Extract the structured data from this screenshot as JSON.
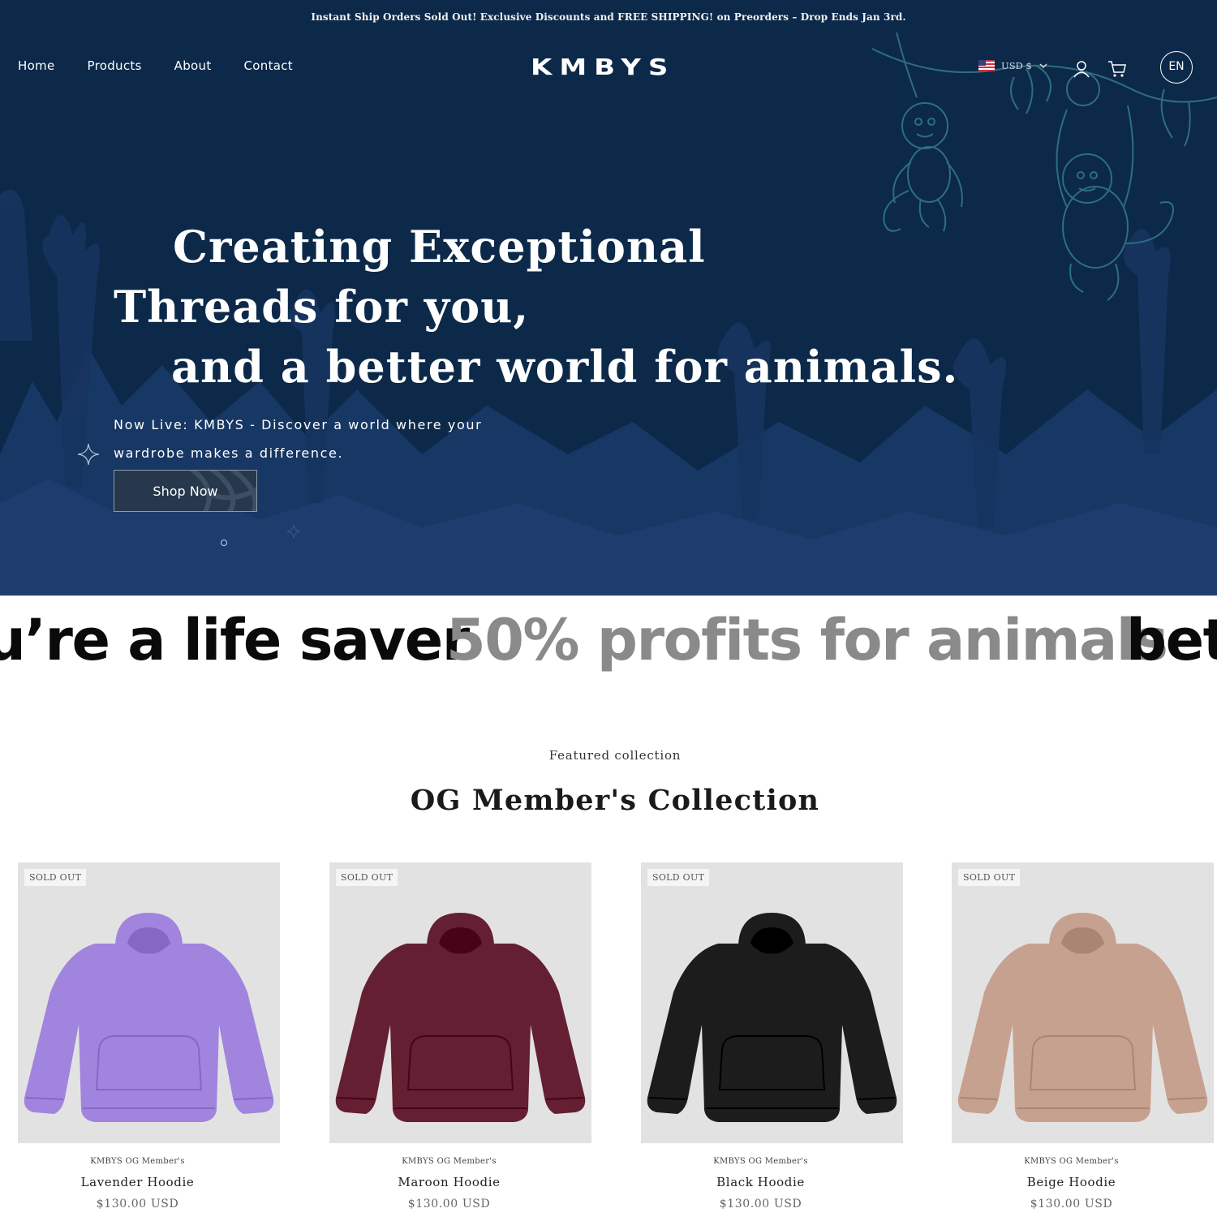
{
  "announcement": "Instant Ship Orders Sold Out! Exclusive Discounts and FREE SHIPPING! on Preorders – Drop Ends Jan 3rd.",
  "nav": [
    "Home",
    "Products",
    "About",
    "Contact"
  ],
  "logo": "KMBYS",
  "currency": "USD $",
  "language": "EN",
  "hero": {
    "title_lines": [
      "Creating Exceptional",
      "Threads for you,",
      "and a better world for animals."
    ],
    "subtitle_lines": [
      "Now Live: KMBYS - Discover a world where your",
      "wardrobe makes a difference."
    ],
    "cta": "Shop Now"
  },
  "marquee": [
    "u’re a life saver",
    "50% profits for animals",
    "bett"
  ],
  "featured": {
    "label": "Featured collection",
    "title": "OG Member's Collection"
  },
  "products": [
    {
      "badge": "SOLD OUT",
      "vendor": "KMBYS OG Member's",
      "name": "Lavender Hoodie",
      "price": "$130.00 USD",
      "color": "#a084de"
    },
    {
      "badge": "SOLD OUT",
      "vendor": "KMBYS OG Member's",
      "name": "Maroon Hoodie",
      "price": "$130.00 USD",
      "color": "#641f33"
    },
    {
      "badge": "SOLD OUT",
      "vendor": "KMBYS OG Member's",
      "name": "Black Hoodie",
      "price": "$130.00 USD",
      "color": "#1c1c1c"
    },
    {
      "badge": "SOLD OUT",
      "vendor": "KMBYS OG Member's",
      "name": "Beige Hoodie",
      "price": "$130.00 USD",
      "color": "#c7a190"
    }
  ],
  "colors": {
    "hero_bg": "#0c2949",
    "jungle": "#1a3a6a",
    "monkey_line": "#2e6e80"
  },
  "icons": [
    "us-flag-icon",
    "chevron-down-icon",
    "user-icon",
    "cart-icon",
    "sparkle-icon",
    "monkey-illustration"
  ]
}
